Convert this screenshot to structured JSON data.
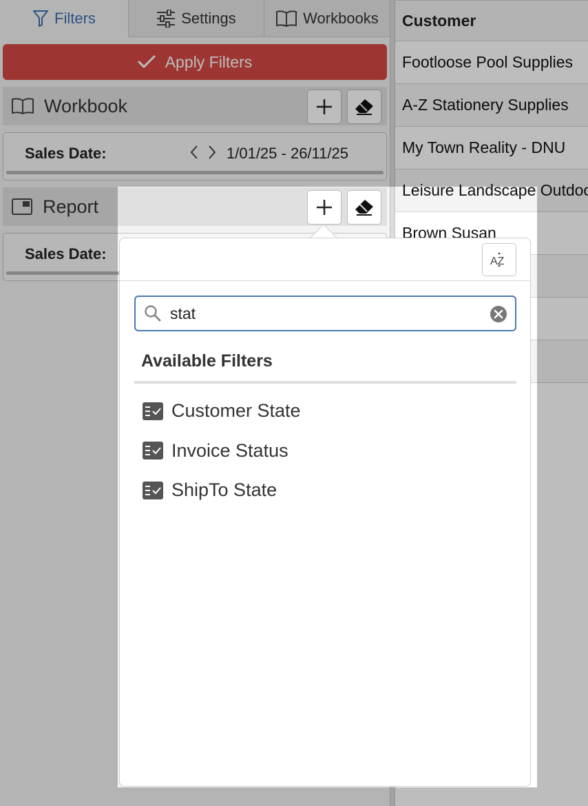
{
  "tabs": {
    "filters": "Filters",
    "settings": "Settings",
    "workbooks": "Workbooks"
  },
  "apply_button": "Apply Filters",
  "workbook_section": {
    "title": "Workbook",
    "date_label": "Sales Date:",
    "date_value": "1/01/25 - 26/11/25"
  },
  "report_section": {
    "title": "Report",
    "date_label": "Sales Date:"
  },
  "table": {
    "header": "Customer",
    "rows": [
      "Footloose Pool Supplies",
      "A-Z Stationery Supplies",
      "My Town Reality - DNU",
      "Leisure Landscape Outdoor",
      "Brown Susan",
      "",
      "",
      ""
    ]
  },
  "popover": {
    "sort_label": "AZ",
    "search_value": "stat",
    "available_title": "Available Filters",
    "filters": [
      "Customer State",
      "Invoice Status",
      "ShipTo State"
    ]
  },
  "colors": {
    "accent": "#3d6fb4",
    "apply": "#d44a44",
    "search_border": "#4a78b0"
  }
}
